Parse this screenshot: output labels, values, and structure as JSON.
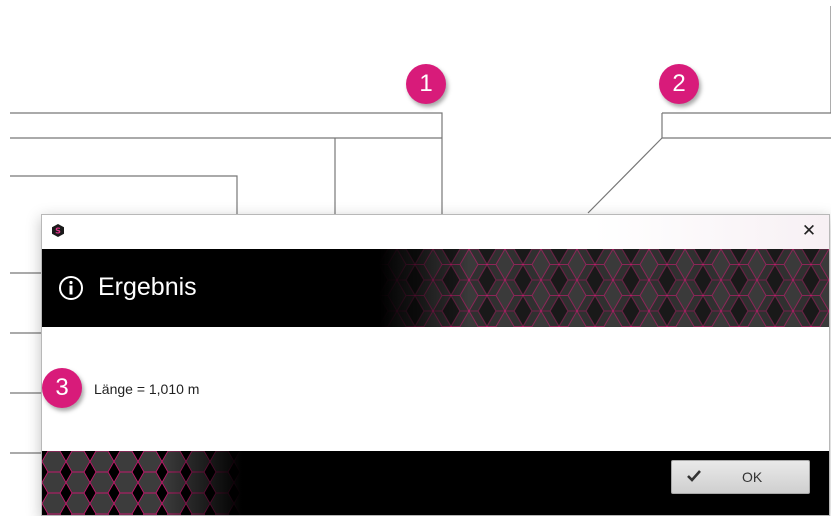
{
  "markers": [
    "1",
    "2",
    "3"
  ],
  "dialog": {
    "app_icon": "app-logo-icon",
    "close_label": "✕",
    "header_title": "Ergebnis",
    "header_icon": "info-icon",
    "result_text": "Länge = 1,010 m",
    "ok_label": "OK",
    "ok_icon": "check-icon"
  },
  "colors": {
    "marker": "#d81b7a",
    "header_bg": "#000000",
    "hex_fill": "#3a3a3a",
    "hex_edge": "#c2186b"
  }
}
